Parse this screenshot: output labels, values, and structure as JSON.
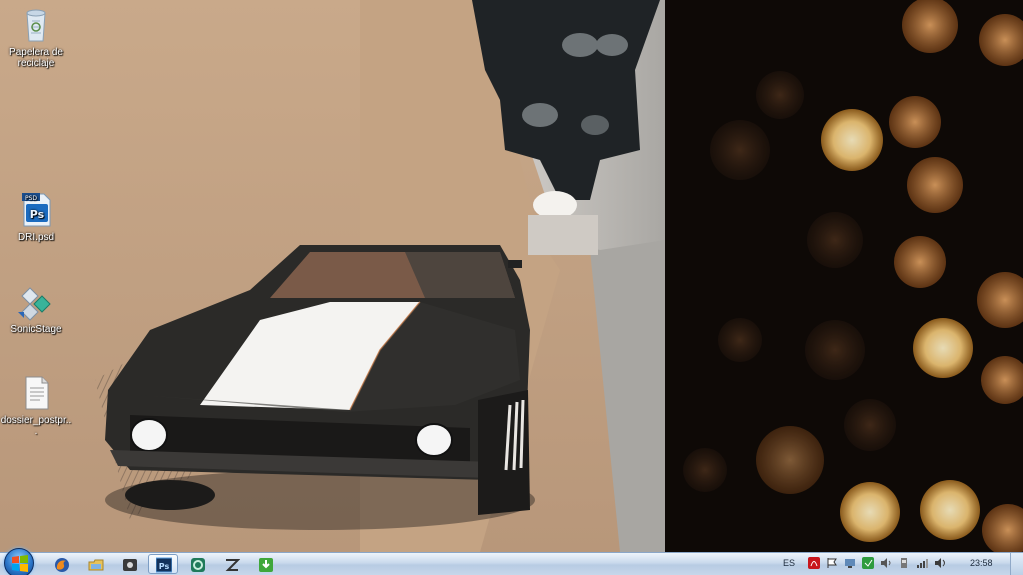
{
  "desktop": {
    "icons": [
      {
        "label": "Papelera de reciclaje",
        "icon": "recycle-bin-icon"
      },
      {
        "label": "DRI.psd",
        "icon": "photoshop-psd-icon"
      },
      {
        "label": "SonicStage",
        "icon": "sonicstage-icon"
      },
      {
        "label": "dossier_postpr...",
        "icon": "document-icon"
      }
    ]
  },
  "taskbar": {
    "start": {
      "icon": "windows-logo-icon"
    },
    "pinned": [
      {
        "icon": "firefox-icon",
        "active": false
      },
      {
        "icon": "windows-explorer-icon",
        "active": false
      },
      {
        "icon": "app-icon",
        "active": false
      },
      {
        "icon": "photoshop-icon",
        "label": "Ps",
        "active": true
      },
      {
        "icon": "green-app-icon",
        "active": false
      },
      {
        "icon": "zbrush-icon",
        "active": false
      },
      {
        "icon": "green-download-icon",
        "active": false
      }
    ],
    "tray": {
      "language": "ES",
      "clock": "23:58",
      "icons": [
        "acrobat-icon",
        "action-center-flag-icon",
        "network-icon",
        "green-tray-icon",
        "volume-icon",
        "usb-device-icon",
        "signal-bars-icon",
        "speaker-icon"
      ]
    }
  }
}
